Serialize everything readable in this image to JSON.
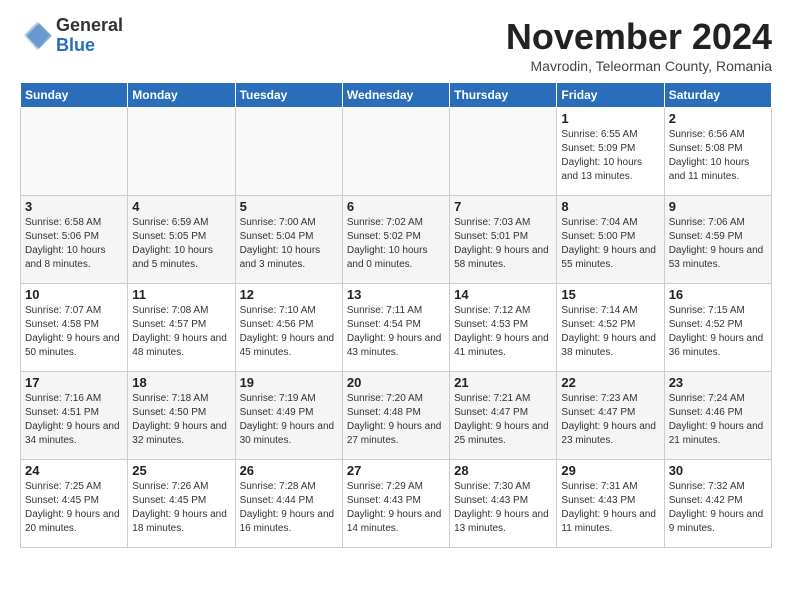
{
  "logo": {
    "general": "General",
    "blue": "Blue"
  },
  "header": {
    "month_title": "November 2024",
    "location": "Mavrodin, Teleorman County, Romania"
  },
  "weekdays": [
    "Sunday",
    "Monday",
    "Tuesday",
    "Wednesday",
    "Thursday",
    "Friday",
    "Saturday"
  ],
  "weeks": [
    [
      {
        "day": "",
        "text": ""
      },
      {
        "day": "",
        "text": ""
      },
      {
        "day": "",
        "text": ""
      },
      {
        "day": "",
        "text": ""
      },
      {
        "day": "",
        "text": ""
      },
      {
        "day": "1",
        "text": "Sunrise: 6:55 AM\nSunset: 5:09 PM\nDaylight: 10 hours and 13 minutes."
      },
      {
        "day": "2",
        "text": "Sunrise: 6:56 AM\nSunset: 5:08 PM\nDaylight: 10 hours and 11 minutes."
      }
    ],
    [
      {
        "day": "3",
        "text": "Sunrise: 6:58 AM\nSunset: 5:06 PM\nDaylight: 10 hours and 8 minutes."
      },
      {
        "day": "4",
        "text": "Sunrise: 6:59 AM\nSunset: 5:05 PM\nDaylight: 10 hours and 5 minutes."
      },
      {
        "day": "5",
        "text": "Sunrise: 7:00 AM\nSunset: 5:04 PM\nDaylight: 10 hours and 3 minutes."
      },
      {
        "day": "6",
        "text": "Sunrise: 7:02 AM\nSunset: 5:02 PM\nDaylight: 10 hours and 0 minutes."
      },
      {
        "day": "7",
        "text": "Sunrise: 7:03 AM\nSunset: 5:01 PM\nDaylight: 9 hours and 58 minutes."
      },
      {
        "day": "8",
        "text": "Sunrise: 7:04 AM\nSunset: 5:00 PM\nDaylight: 9 hours and 55 minutes."
      },
      {
        "day": "9",
        "text": "Sunrise: 7:06 AM\nSunset: 4:59 PM\nDaylight: 9 hours and 53 minutes."
      }
    ],
    [
      {
        "day": "10",
        "text": "Sunrise: 7:07 AM\nSunset: 4:58 PM\nDaylight: 9 hours and 50 minutes."
      },
      {
        "day": "11",
        "text": "Sunrise: 7:08 AM\nSunset: 4:57 PM\nDaylight: 9 hours and 48 minutes."
      },
      {
        "day": "12",
        "text": "Sunrise: 7:10 AM\nSunset: 4:56 PM\nDaylight: 9 hours and 45 minutes."
      },
      {
        "day": "13",
        "text": "Sunrise: 7:11 AM\nSunset: 4:54 PM\nDaylight: 9 hours and 43 minutes."
      },
      {
        "day": "14",
        "text": "Sunrise: 7:12 AM\nSunset: 4:53 PM\nDaylight: 9 hours and 41 minutes."
      },
      {
        "day": "15",
        "text": "Sunrise: 7:14 AM\nSunset: 4:52 PM\nDaylight: 9 hours and 38 minutes."
      },
      {
        "day": "16",
        "text": "Sunrise: 7:15 AM\nSunset: 4:52 PM\nDaylight: 9 hours and 36 minutes."
      }
    ],
    [
      {
        "day": "17",
        "text": "Sunrise: 7:16 AM\nSunset: 4:51 PM\nDaylight: 9 hours and 34 minutes."
      },
      {
        "day": "18",
        "text": "Sunrise: 7:18 AM\nSunset: 4:50 PM\nDaylight: 9 hours and 32 minutes."
      },
      {
        "day": "19",
        "text": "Sunrise: 7:19 AM\nSunset: 4:49 PM\nDaylight: 9 hours and 30 minutes."
      },
      {
        "day": "20",
        "text": "Sunrise: 7:20 AM\nSunset: 4:48 PM\nDaylight: 9 hours and 27 minutes."
      },
      {
        "day": "21",
        "text": "Sunrise: 7:21 AM\nSunset: 4:47 PM\nDaylight: 9 hours and 25 minutes."
      },
      {
        "day": "22",
        "text": "Sunrise: 7:23 AM\nSunset: 4:47 PM\nDaylight: 9 hours and 23 minutes."
      },
      {
        "day": "23",
        "text": "Sunrise: 7:24 AM\nSunset: 4:46 PM\nDaylight: 9 hours and 21 minutes."
      }
    ],
    [
      {
        "day": "24",
        "text": "Sunrise: 7:25 AM\nSunset: 4:45 PM\nDaylight: 9 hours and 20 minutes."
      },
      {
        "day": "25",
        "text": "Sunrise: 7:26 AM\nSunset: 4:45 PM\nDaylight: 9 hours and 18 minutes."
      },
      {
        "day": "26",
        "text": "Sunrise: 7:28 AM\nSunset: 4:44 PM\nDaylight: 9 hours and 16 minutes."
      },
      {
        "day": "27",
        "text": "Sunrise: 7:29 AM\nSunset: 4:43 PM\nDaylight: 9 hours and 14 minutes."
      },
      {
        "day": "28",
        "text": "Sunrise: 7:30 AM\nSunset: 4:43 PM\nDaylight: 9 hours and 13 minutes."
      },
      {
        "day": "29",
        "text": "Sunrise: 7:31 AM\nSunset: 4:43 PM\nDaylight: 9 hours and 11 minutes."
      },
      {
        "day": "30",
        "text": "Sunrise: 7:32 AM\nSunset: 4:42 PM\nDaylight: 9 hours and 9 minutes."
      }
    ]
  ]
}
